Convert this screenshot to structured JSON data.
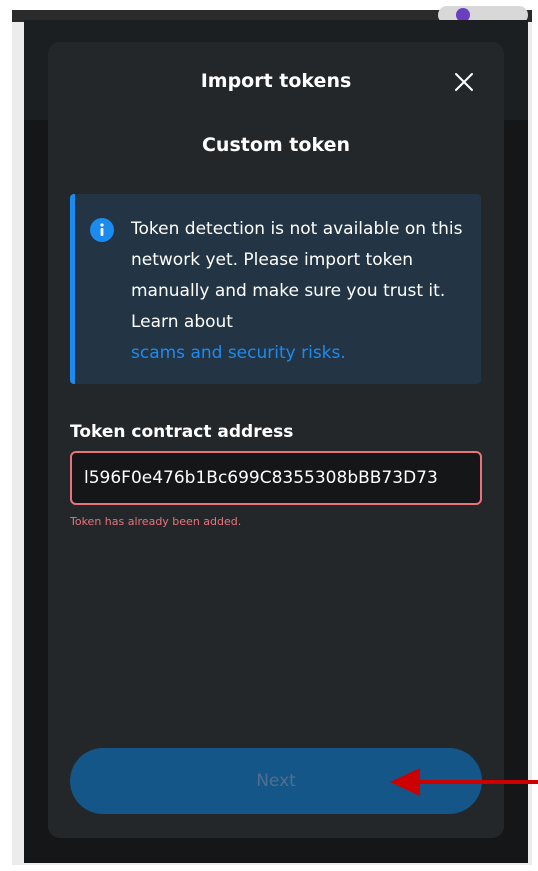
{
  "modal": {
    "title": "Import tokens",
    "subtitle": "Custom token",
    "close_icon": "close-icon"
  },
  "banner": {
    "icon": "info-icon",
    "text": "Token detection is not available on this network yet. Please import token manually and make sure you trust it. Learn about",
    "link_text": "scams and security risks."
  },
  "address_field": {
    "label": "Token contract address",
    "value": "l596F0e476b1Bc699C8355308bBB73D73",
    "error": "Token has already been added."
  },
  "next_button": {
    "label": "Next"
  },
  "colors": {
    "background": "#141618",
    "modal": "#24272a",
    "accent_blue": "#1c8bf0",
    "error": "#e8737d",
    "button_disabled": "#145688",
    "annotation_arrow": "#cc0000"
  }
}
